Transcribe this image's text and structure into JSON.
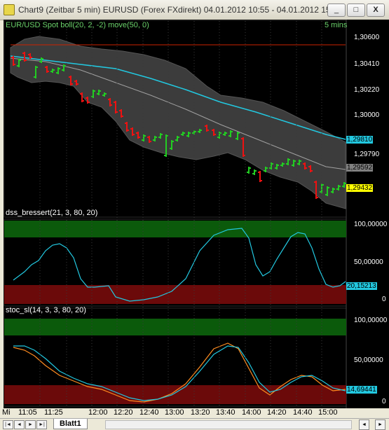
{
  "window": {
    "title": "Chart9 (Zeitbar 5 min)  EURUSD (Forex FXdirekt) 04.01.2012 10:55 - 04.01.2012 15:…",
    "buttons": [
      "_",
      "□",
      "X"
    ]
  },
  "colors": {
    "bull": "#22cc22",
    "bear": "#ee1111",
    "ma_fast": "#22c8e0",
    "ma_slow": "#a0a0a0",
    "band_fill": "#3c3c3c",
    "level_line": "#cc2200",
    "overbought_zone": "#0b5a0b",
    "oversold_zone": "#6b0a0a"
  },
  "price_panel": {
    "label": "EUR/USD Spot boll(20, 2, -2) move(50, 0)",
    "interval": "5 mins",
    "axis_ticks": [
      "1,30600",
      "1,30410",
      "1,30220",
      "1,30000",
      "1,29790",
      "1,29592",
      "1,29432",
      "1,29400"
    ],
    "tags": [
      {
        "text": "1,29810",
        "bg": "#22c8e0",
        "fg": "#000000"
      },
      {
        "text": "1,29592",
        "bg": "#808080",
        "fg": "#000000"
      },
      {
        "text": "1,29432",
        "bg": "#ffff00",
        "fg": "#000000"
      }
    ]
  },
  "dss_panel": {
    "label": "dss_bressert(21, 3, 80, 20)",
    "axis_ticks": [
      "100,00000",
      "50,00000",
      "0"
    ],
    "tag": {
      "text": "20,15213",
      "bg": "#22c8e0",
      "fg": "#000000"
    }
  },
  "stoc_panel": {
    "label": "stoc_sl(14, 3, 3, 80, 20)",
    "axis_ticks": [
      "100,00000",
      "50,00000",
      "0"
    ],
    "tag": {
      "text": "14,69441",
      "bg": "#22c8e0",
      "fg": "#000000"
    }
  },
  "time_axis": {
    "day_label": "Mi",
    "labels": [
      "11:05",
      "11:25",
      "12:00",
      "12:20",
      "12:40",
      "13:00",
      "13:20",
      "13:40",
      "14:00",
      "14:20",
      "14:40",
      "15:00"
    ]
  },
  "sheet_tabs": {
    "active": "Blatt1",
    "nav": [
      "|◄",
      "◄",
      "►",
      "►|"
    ]
  }
}
